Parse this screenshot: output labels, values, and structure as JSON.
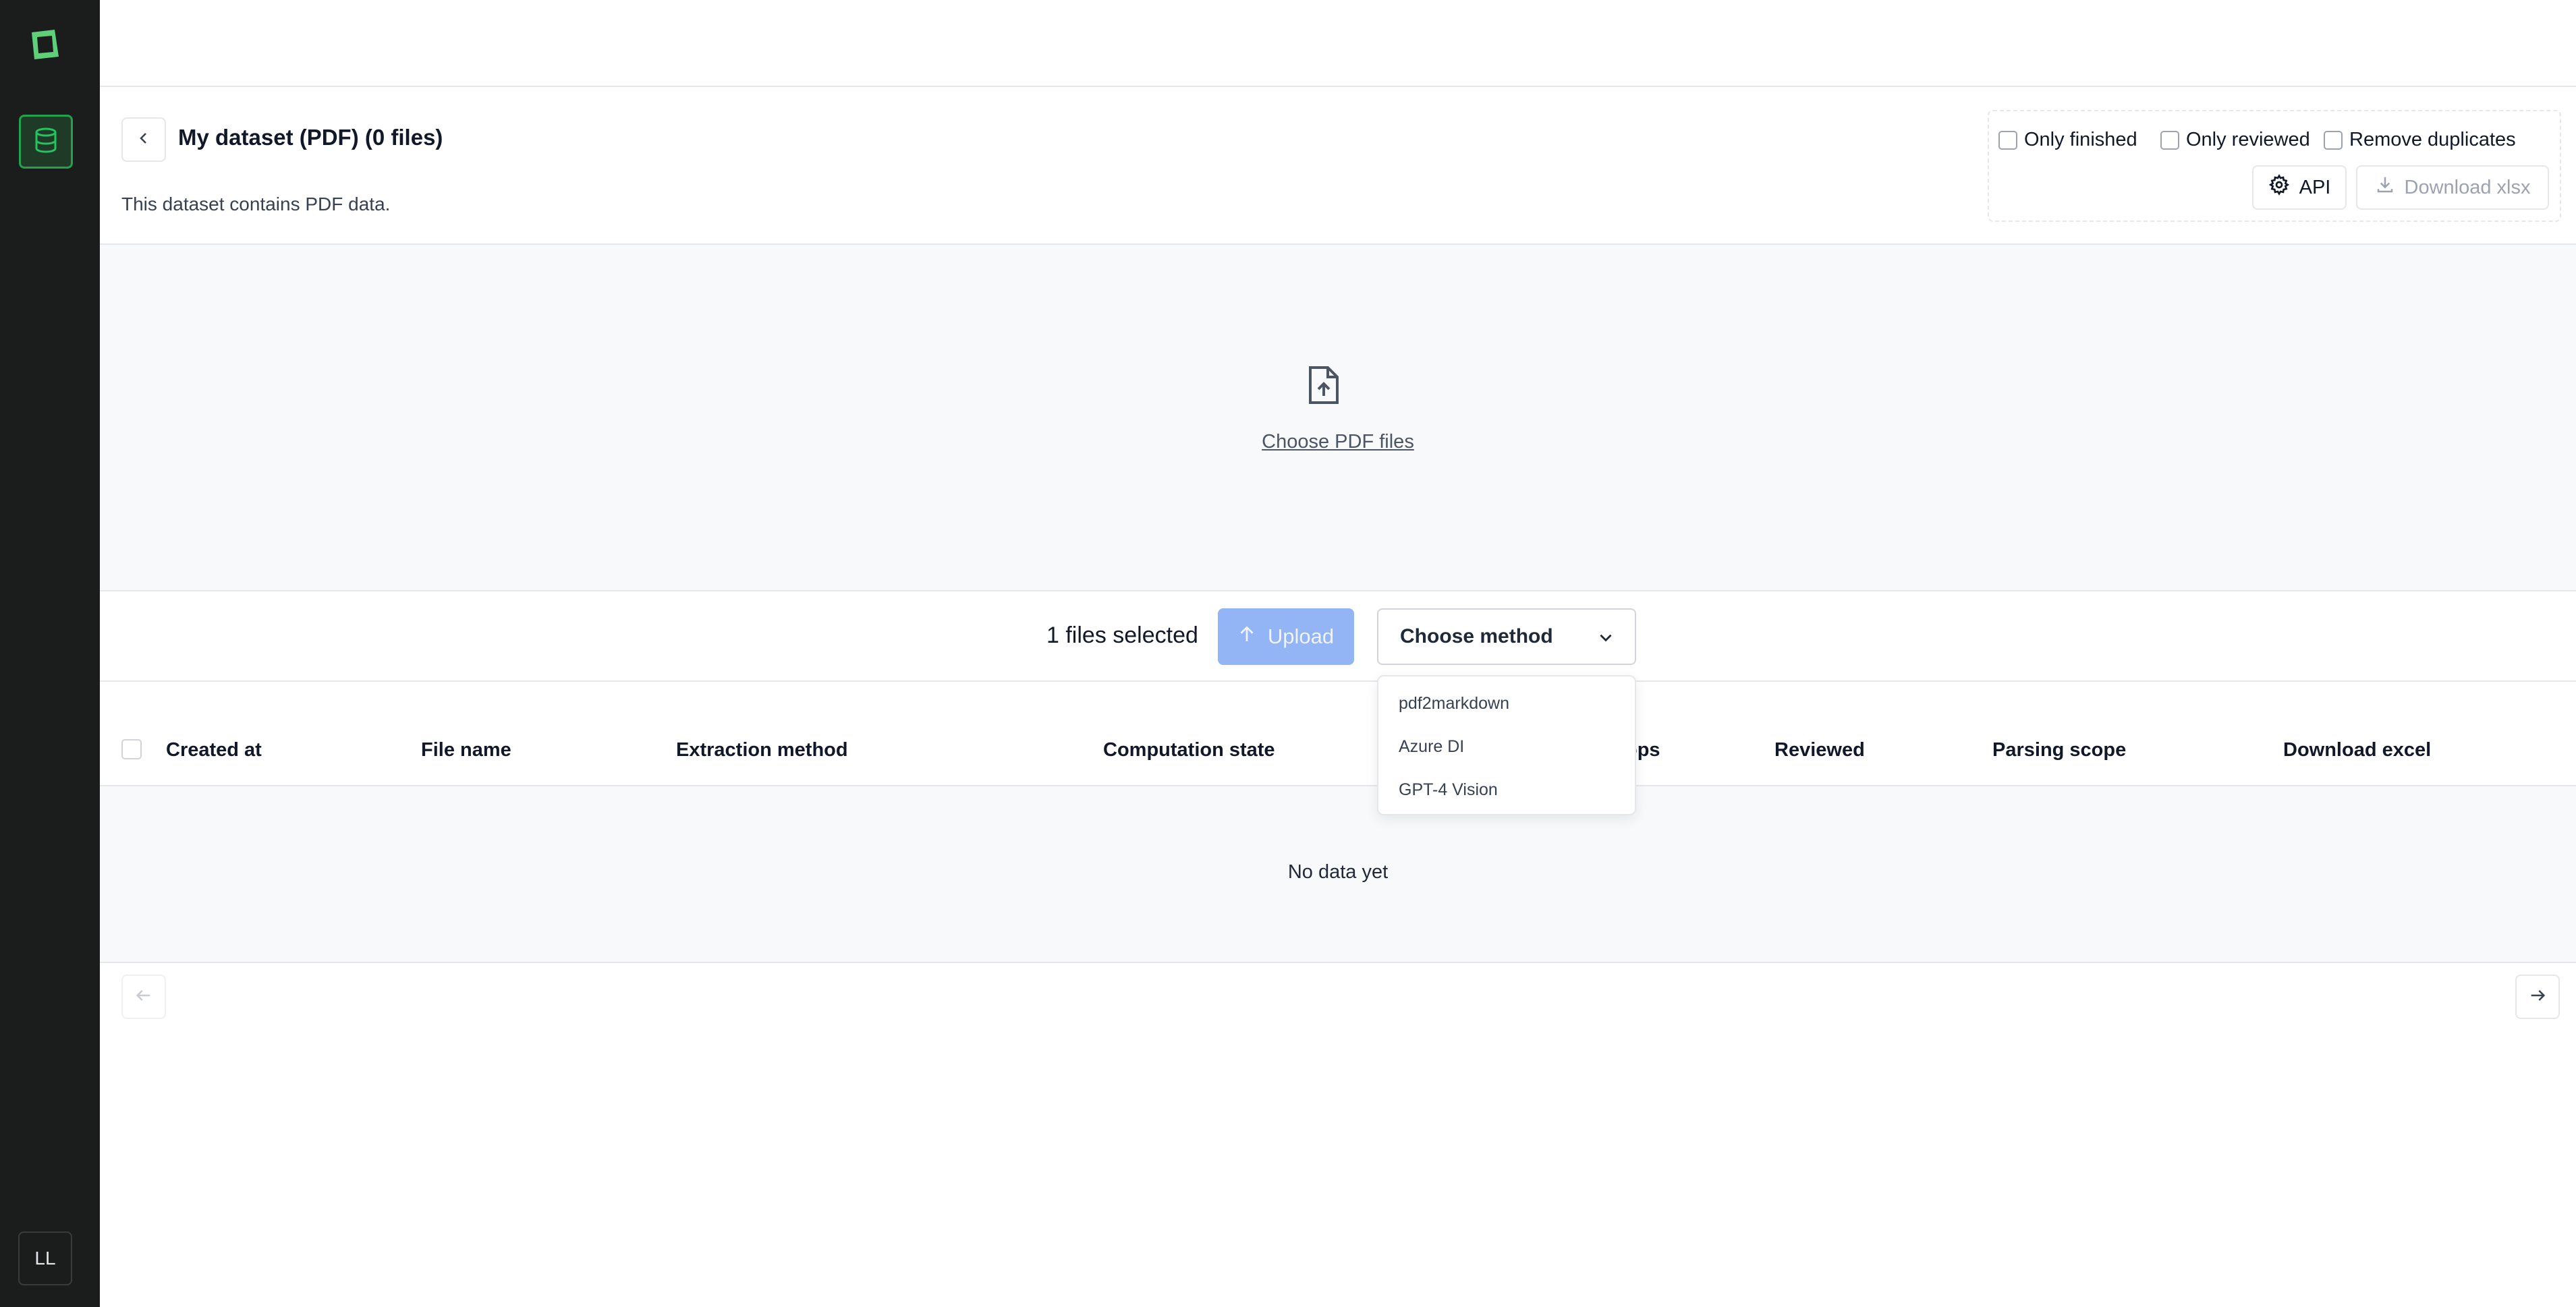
{
  "sidebar": {
    "avatar_initials": "LL",
    "accent_color": "#22a24b"
  },
  "header": {
    "title": "My dataset (PDF) (0 files)",
    "description": "This dataset contains PDF data.",
    "filters": {
      "only_finished": "Only finished",
      "only_reviewed": "Only reviewed",
      "remove_duplicates": "Remove duplicates"
    },
    "api_label": "API",
    "download_label": "Download xlsx"
  },
  "dropzone": {
    "choose_label": "Choose PDF files"
  },
  "upload_bar": {
    "files_selected": "1 files selected",
    "upload_label": "Upload",
    "method_placeholder": "Choose method",
    "method_options": [
      "pdf2markdown",
      "Azure DI",
      "GPT-4 Vision"
    ]
  },
  "table": {
    "columns": [
      "Created at",
      "File name",
      "Extraction method",
      "Computation state",
      "ops",
      "Reviewed",
      "Parsing scope",
      "Download excel"
    ],
    "empty_text": "No data yet"
  }
}
